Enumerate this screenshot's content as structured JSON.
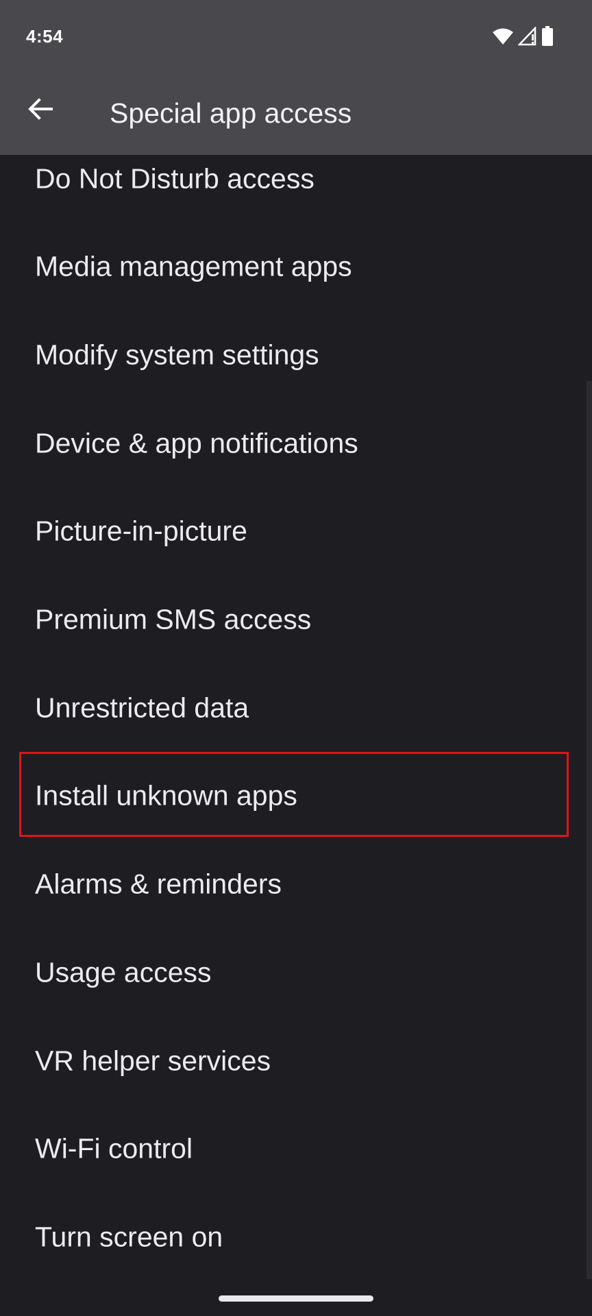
{
  "status_bar": {
    "time": "4:54",
    "icons": [
      "wifi-icon",
      "cellular-signal-icon",
      "battery-icon"
    ]
  },
  "app_bar": {
    "back_icon": "arrow-back-icon",
    "title": "Special app access"
  },
  "list": {
    "items": [
      {
        "label": "Do Not Disturb access"
      },
      {
        "label": "Media management apps"
      },
      {
        "label": "Modify system settings"
      },
      {
        "label": "Device & app notifications"
      },
      {
        "label": "Picture-in-picture"
      },
      {
        "label": "Premium SMS access"
      },
      {
        "label": "Unrestricted data"
      },
      {
        "label": "Install unknown apps",
        "highlighted": true
      },
      {
        "label": "Alarms & reminders"
      },
      {
        "label": "Usage access"
      },
      {
        "label": "VR helper services"
      },
      {
        "label": "Wi-Fi control"
      },
      {
        "label": "Turn screen on"
      }
    ]
  },
  "colors": {
    "background": "#1e1d22",
    "app_bar": "#48484d",
    "text": "#ecebf0",
    "highlight": "#e0121b"
  }
}
